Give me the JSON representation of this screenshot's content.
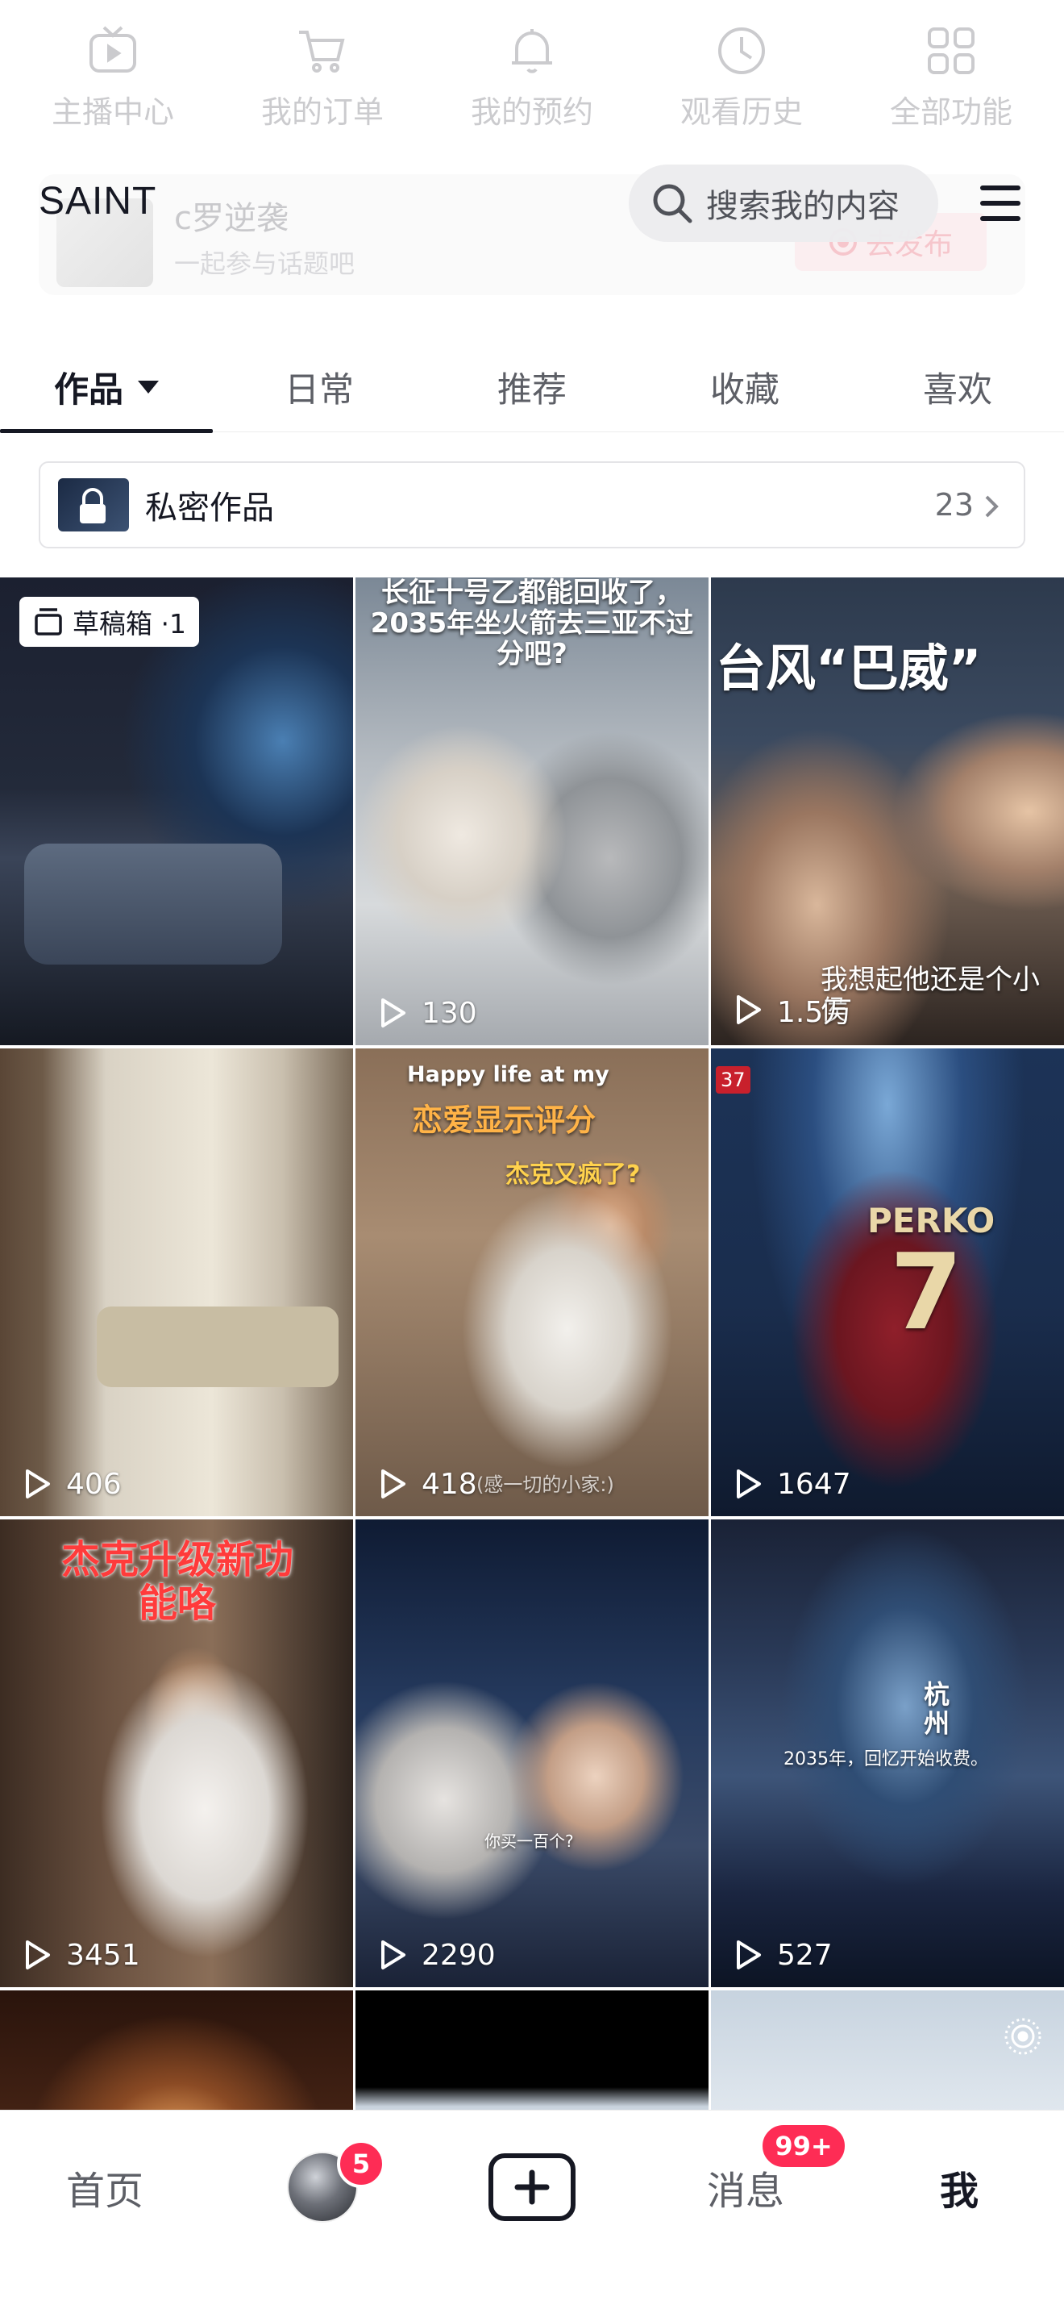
{
  "quick_functions": [
    {
      "label": "主播中心",
      "icon": "tv-icon"
    },
    {
      "label": "我的订单",
      "icon": "cart-icon"
    },
    {
      "label": "我的预约",
      "icon": "bell-icon"
    },
    {
      "label": "观看历史",
      "icon": "clock-icon"
    },
    {
      "label": "全部功能",
      "icon": "grid-icon"
    }
  ],
  "promo": {
    "title": "c罗逆袭",
    "subtitle": "一起参与话题吧",
    "button": "去发布"
  },
  "header": {
    "name": "SAINT",
    "search_placeholder": "搜索我的内容"
  },
  "tabs": [
    {
      "label": "作品",
      "active": true
    },
    {
      "label": "日常",
      "active": false
    },
    {
      "label": "推荐",
      "active": false
    },
    {
      "label": "收藏",
      "active": false
    },
    {
      "label": "喜欢",
      "active": false
    }
  ],
  "private_works": {
    "label": "私密作品",
    "count": "23"
  },
  "drafts": {
    "label": "草稿箱 ·1"
  },
  "videos": [
    {
      "plays": "",
      "overlay": ""
    },
    {
      "plays": "130",
      "overlay": "长征十号乙都能回收了，2035年坐火箭去三亚不过分吧?"
    },
    {
      "plays": "1.5万",
      "overlay": "台风“巴威”",
      "caption": "我想起他还是个小侯"
    },
    {
      "plays": "406",
      "overlay": ""
    },
    {
      "plays": "418",
      "overlay": "Happy life at my",
      "overlay2": "恋爱显示评分",
      "overlay3": "杰克又疯了?",
      "caption": "(感一切的小家:)"
    },
    {
      "plays": "1647",
      "overlay": "",
      "jersey": "PERKO",
      "jersey_num": "7",
      "tag": "37"
    },
    {
      "plays": "3451",
      "overlay": "杰克升级新功能咯"
    },
    {
      "plays": "2290",
      "overlay": "你买一百个?"
    },
    {
      "plays": "527",
      "overlay": "杭州",
      "caption": "2035年，回忆开始收费。"
    }
  ],
  "bottom_nav": {
    "home": "首页",
    "friends_badge": "5",
    "messages": "消息",
    "messages_badge": "99+",
    "me": "我"
  }
}
